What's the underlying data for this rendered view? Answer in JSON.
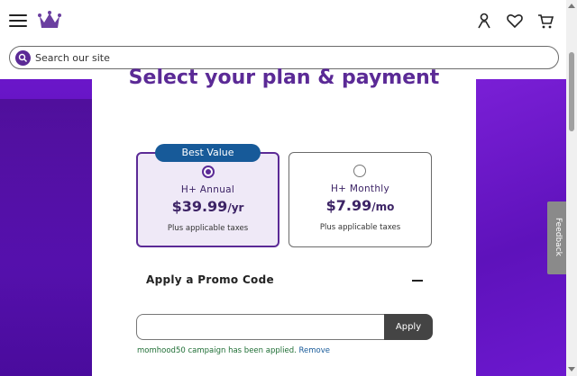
{
  "header": {
    "menu_icon": "hamburger-menu-icon",
    "logo_icon": "crown-logo-icon",
    "account_icon": "person-icon",
    "wishlist_icon": "heart-icon",
    "cart_icon": "cart-icon"
  },
  "search": {
    "placeholder": "Search our site",
    "icon": "search-icon"
  },
  "page": {
    "title": "Select your plan & payment"
  },
  "plans": [
    {
      "badge": "Best Value",
      "name": "H+ Annual",
      "price": "$39.99",
      "unit": "/yr",
      "tax_note": "Plus applicable taxes",
      "selected": true
    },
    {
      "badge": "",
      "name": "H+ Monthly",
      "price": "$7.99",
      "unit": "/mo",
      "tax_note": "Plus applicable taxes",
      "selected": false
    }
  ],
  "promo": {
    "label": "Apply a Promo Code",
    "input_value": "",
    "apply_label": "Apply",
    "applied_message": "momhood50 campaign has been applied.",
    "remove_label": "Remove"
  },
  "feedback": {
    "label": "Feedback"
  },
  "colors": {
    "brand_purple": "#5b2a96",
    "badge_blue": "#175a99",
    "backdrop_purple": "#6a16c9"
  }
}
